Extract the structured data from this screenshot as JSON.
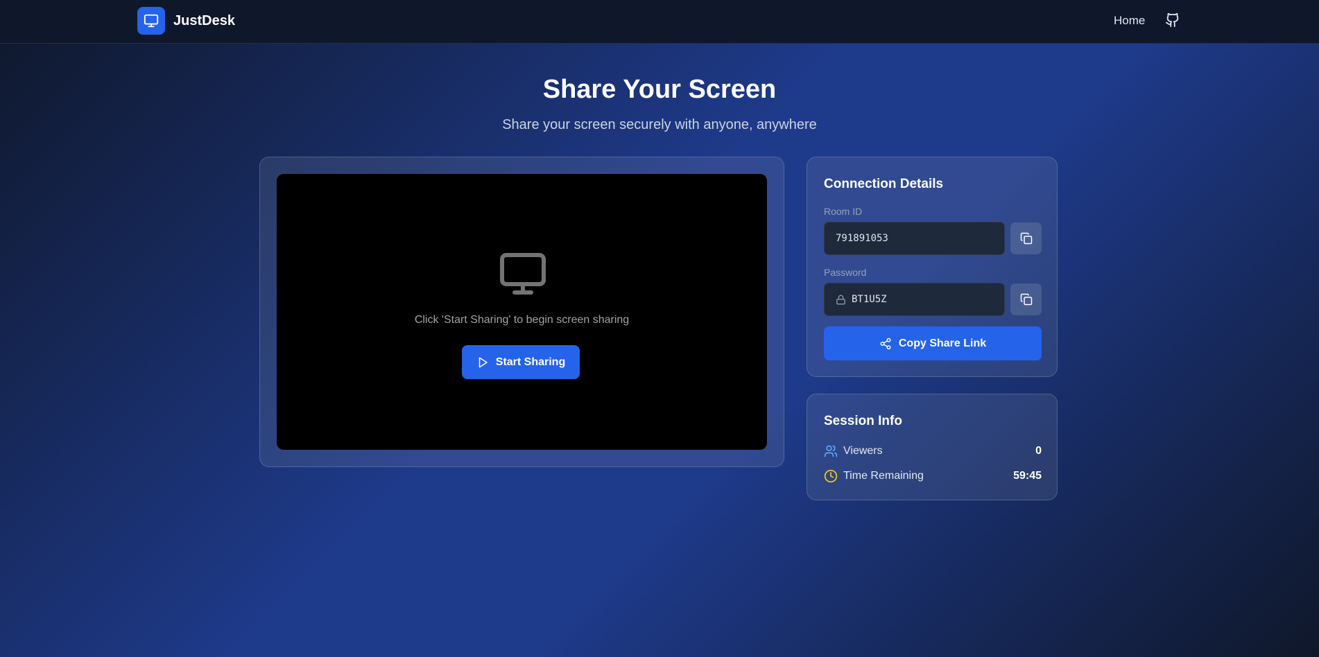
{
  "app": {
    "brand_name": "JustDesk",
    "nav": {
      "home_label": "Home"
    }
  },
  "hero": {
    "title": "Share Your Screen",
    "subtitle": "Share your screen securely with anyone, anywhere"
  },
  "share": {
    "hint": "Click 'Start Sharing' to begin screen sharing",
    "start_label": "Start Sharing"
  },
  "connection": {
    "title": "Connection Details",
    "room_id_label": "Room ID",
    "room_id": "791891053",
    "password_label": "Password",
    "password": "BT1U5Z",
    "share_link_label": "Copy Share Link"
  },
  "session": {
    "title": "Session Info",
    "viewers_label": "Viewers",
    "viewers": "0",
    "time_label": "Time Remaining",
    "time": "59:45"
  },
  "icons": {
    "brand": "monitor-icon",
    "github": "github-icon",
    "screen_placeholder": "monitor-icon",
    "start": "play-icon",
    "copy": "copy-icon",
    "lock": "lock-icon",
    "share": "share-icon",
    "viewers": "users-icon",
    "time": "clock-icon"
  },
  "colors": {
    "accent": "#2563eb",
    "background": "#0f172a",
    "viewers_icon": "#60a5fa",
    "clock_icon": "#facc15"
  }
}
